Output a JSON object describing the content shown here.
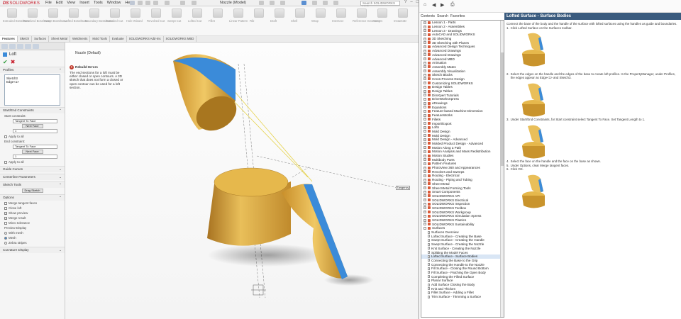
{
  "app": {
    "logo_ds": "DS",
    "logo_name": "SOLIDWORKS",
    "doc_title": "Nozzle (Model)",
    "search_placeholder": "Search SOLIDWORKS Help",
    "win_controls": [
      "?",
      "–",
      "□",
      "×"
    ]
  },
  "menu": [
    "File",
    "Edit",
    "View",
    "Insert",
    "Tools",
    "Window",
    "Help"
  ],
  "tabs": [
    "Features",
    "Sketch",
    "Surfaces",
    "Sheet Metal",
    "Weldments",
    "Mold Tools",
    "Evaluate",
    "SOLIDWORKS Add-Ins",
    "SOLIDWORKS MBD"
  ],
  "ribbon_labels": [
    "Extruded Boss/Base",
    "Revolved Boss/Base",
    "Swept Boss/Base",
    "Lofted Boss/Base",
    "Boundary Boss/Base",
    "Extruded Cut",
    "Hole Wizard",
    "Revolved Cut",
    "Swept Cut",
    "Lofted Cut",
    "Fillet",
    "Linear Pattern",
    "Rib",
    "Draft",
    "Shell",
    "Wrap",
    "Intersect",
    "Reference Geometry",
    "Curves",
    "Instant3D"
  ],
  "property_manager": {
    "title": "Loft",
    "sections": {
      "profiles": "Profiles",
      "start_end": "Start/End Constraints",
      "guide_curves": "Guide Curves",
      "centerline": "Centerline Parameters",
      "sketch_tools": "Sketch Tools",
      "options": "Options",
      "preview": "Preview Display",
      "curvature": "Curvature Display"
    },
    "profiles": [
      "Sketch3",
      "Edge<1>"
    ],
    "start_label": "Start constraint:",
    "start_value": "Tangent To Face",
    "next_face": "Next Face",
    "end_label": "End constraint:",
    "end_value": "Tangent To Face",
    "next_face2": "Next Face",
    "tangent_length": "1",
    "tangent_length2": "1",
    "apply_all": "Apply to all",
    "drag_sketch": "Drag Sketch",
    "options_items": [
      "Merge tangent faces",
      "Close loft",
      "Show preview",
      "Merge result",
      "Micro tolerance"
    ],
    "preview_items": [
      "With mesh",
      "Mesh",
      "Zebra stripes"
    ]
  },
  "viewport": {
    "crumb": "Nozzle (Default)",
    "alert_title": "Rebuild Errors",
    "alert_text": "The end sections for a loft must be either closed or open contours. A 3D sketch that does not form a closed or open contour can be used for a loft section.",
    "tag": "Tangency"
  },
  "help": {
    "tabs": [
      "Contents",
      "Search",
      "Favorites"
    ],
    "toc": [
      "Lesson 1 - Parts",
      "Lesson 2 - Assemblies",
      "Lesson 3 - Drawings",
      "AutoCAD and SOLIDWORKS",
      "3D Sketching",
      "3D Sketching with Planes",
      "Advanced Design Techniques",
      "Advanced Drawings",
      "Advanced Drawings",
      "Advanced MBD",
      "Animation",
      "Assembly Mates",
      "Assembly Visualization",
      "Sketch Blocks",
      "Cross-Process Design",
      "Customizing SOLIDWORKS",
      "Design Tables",
      "Design Tables",
      "DimXpert Tutorials",
      "DriveWorksXpress",
      "eDrawings",
      "Equations",
      "Feature-based Machine Dimension",
      "FeatureWorks",
      "Fillets",
      "Import/Export",
      "Lofts",
      "Mold Design",
      "Mold Design",
      "Mold Design - Advanced",
      "Molded Product Design - Advanced",
      "Motion Along a Path",
      "Motion Analysis and Mass Redistribution",
      "Motion Studies",
      "Multibody Parts",
      "Pattern Features",
      "PhotoView 360 and Appearances",
      "Revolves and Sweeps",
      "Routing - Electrical",
      "Routing - Piping and Tubing",
      "Sheet Metal",
      "Sheet Metal Forming Tools",
      "Smart Components",
      "SOLIDWORKS API",
      "SOLIDWORKS Electrical",
      "SOLIDWORKS Inspection",
      "SOLIDWORKS Toolbox",
      "SOLIDWORKS Workgroup",
      "SOLIDWORKS Simulation Xpress",
      "SOLIDWORKS Plastics",
      "SOLIDWORKS Sustainability"
    ],
    "surfaces_header": "Surfaces",
    "surfaces_items": [
      "Surfaces Overview",
      "Lofted Surface - Creating the Base",
      "Swept Surface - Creating the Handle",
      "Swept Surface - Creating the Nozzle",
      "Knit Surface - Creating the Nozzle",
      "Splitting the Model Faces",
      "Lofted Surface - Surface Bodies",
      "Connecting the Base to the Grip",
      "Connecting the Handle to the Nozzle",
      "Fill Surface - Closing the Round Bottom",
      "Fill Surface - Patching the Open Body",
      "Completing the Filled Surface",
      "Planar Surface",
      "Add Surface Closing the Body",
      "Knit and Thicken",
      "Fillet Surface - Adding a Fillet",
      "Trim Surface - Trimming a Surface"
    ],
    "topic_title": "Lofted Surface - Surface Bodies",
    "topic_intro": "Connect the base of the body and the handle of the surface with lofted surfaces using the handles as guide and boundaries.",
    "steps": [
      "Click Lofted Surface on the Surfaces toolbar.",
      "Select the edges on the handle and the edges of the base to create loft profiles. In the PropertyManager, under Profiles, the edges appear as Edge<1> and Sketch3.",
      "Under Start/End Constraints, for Start constraint select Tangent To Face. Set Tangent Length to 1.",
      "Select the face on the handle and the face on the base as shown.",
      "Under Options, clear Merge tangent faces.",
      "Click OK."
    ]
  },
  "colors": {
    "body": "#e8b94a",
    "highlight": "#3b8bd9",
    "accent": "#3a5b7e",
    "error": "#c0392b"
  }
}
